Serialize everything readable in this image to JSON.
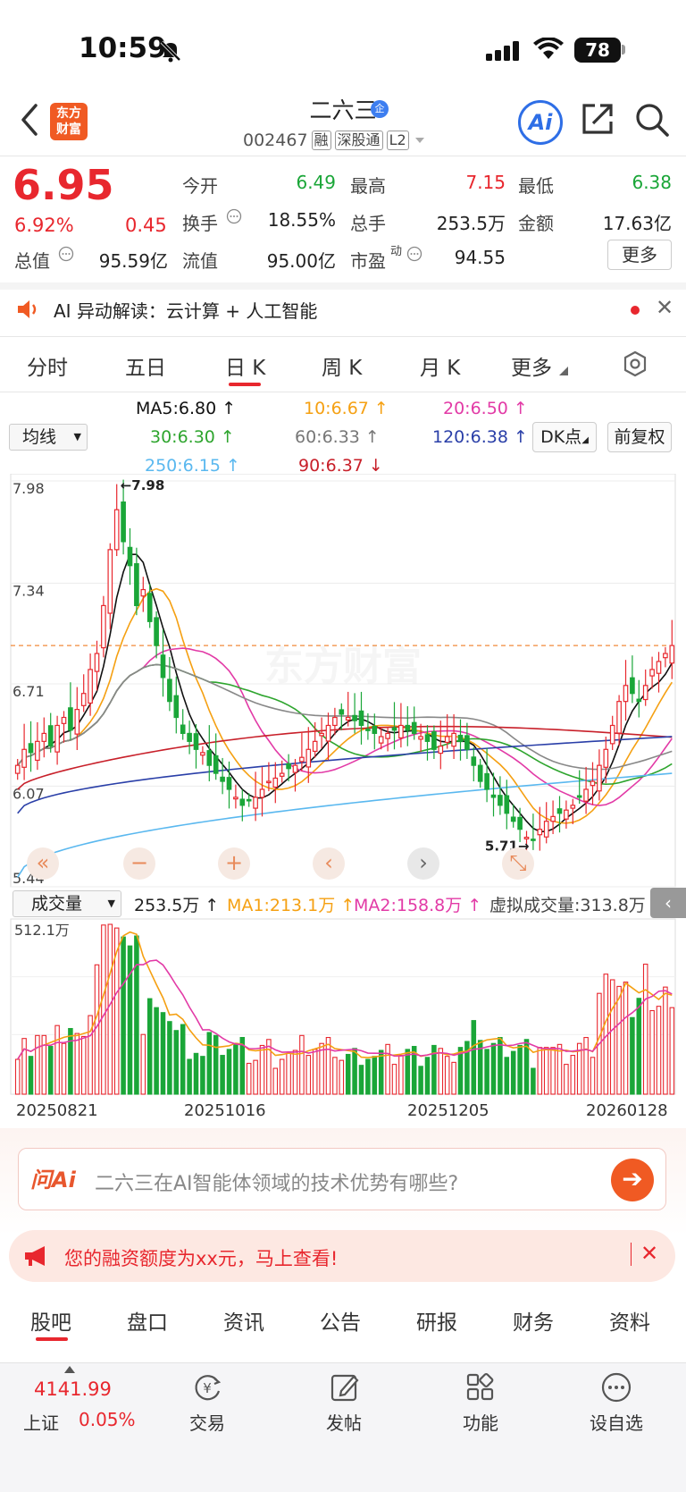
{
  "status_bar": {
    "time": "10:59",
    "battery": "78"
  },
  "header": {
    "stock_name": "二六三",
    "badge": "企",
    "code": "002467",
    "tags": [
      "融",
      "深股通",
      "L2"
    ],
    "logo_line1": "东方",
    "logo_line2": "财富",
    "ai_label": "Ai"
  },
  "quote": {
    "price": "6.95",
    "change_pct": "6.92%",
    "change": "0.45",
    "fields": [
      {
        "label": "今开",
        "value": "6.49",
        "color": "#1aa638"
      },
      {
        "label": "最高",
        "value": "7.15",
        "color": "#e8272e"
      },
      {
        "label": "最低",
        "value": "6.38",
        "color": "#1aa638"
      },
      {
        "label": "换手",
        "value": "18.55%",
        "color": "#222222"
      },
      {
        "label": "总手",
        "value": "253.5万",
        "color": "#222222"
      },
      {
        "label": "金额",
        "value": "17.63亿",
        "color": "#222222"
      },
      {
        "label": "总值",
        "value": "95.59亿",
        "color": "#222222"
      },
      {
        "label": "流值",
        "value": "95.00亿",
        "color": "#222222"
      },
      {
        "label": "市盈",
        "value": "94.55",
        "color": "#222222"
      }
    ],
    "pe_sup": "动",
    "more_label": "更多"
  },
  "ai_bar": {
    "text": "AI 异动解读：云计算 + 人工智能"
  },
  "chart_tabs": [
    "分时",
    "五日",
    "日 K",
    "周 K",
    "月 K",
    "更多"
  ],
  "ma_labels": {
    "select": "均线",
    "ma5": "MA5:6.80 ↑",
    "ma10": "10:6.67 ↑",
    "ma20": "20:6.50 ↑",
    "ma30": "30:6.30 ↑",
    "ma60": "60:6.33 ↑",
    "ma120": "120:6.38 ↑",
    "ma250": "250:6.15 ↑",
    "ma90": "90:6.37 ↓",
    "dk_btn": "DK点",
    "fq_btn": "前复权"
  },
  "colors": {
    "red": "#e8272e",
    "green": "#1aa638",
    "ma5": "#111111",
    "ma10": "#f5a012",
    "ma20": "#e23aa6",
    "ma30": "#2ea52e",
    "ma60": "#888888",
    "ma90": "#c8202a",
    "ma120": "#2a3fa8",
    "ma250": "#5ab8ef"
  },
  "chart_data": {
    "type": "candlestick",
    "y_ticks": [
      "7.98",
      "7.34",
      "6.71",
      "6.07",
      "5.44"
    ],
    "ylim": [
      5.44,
      7.98
    ],
    "high_label": "←7.98",
    "low_label": "5.71→",
    "last_close": 6.95,
    "close": [
      6.2,
      6.3,
      6.28,
      6.35,
      6.4,
      6.32,
      6.45,
      6.5,
      6.42,
      6.55,
      6.65,
      6.8,
      6.9,
      7.2,
      7.55,
      7.8,
      7.6,
      7.45,
      7.2,
      7.3,
      7.1,
      6.95,
      6.75,
      6.6,
      6.5,
      6.4,
      6.35,
      6.3,
      6.28,
      6.2,
      6.15,
      6.1,
      6.05,
      6.0,
      5.95,
      5.98,
      6.0,
      6.05,
      6.1,
      6.12,
      6.15,
      6.18,
      6.2,
      6.25,
      6.3,
      6.35,
      6.4,
      6.45,
      6.5,
      6.52,
      6.5,
      6.48,
      6.45,
      6.42,
      6.4,
      6.38,
      6.4,
      6.42,
      6.45,
      6.42,
      6.4,
      6.38,
      6.35,
      6.3,
      6.32,
      6.38,
      6.4,
      6.35,
      6.3,
      6.2,
      6.1,
      6.05,
      6.0,
      5.95,
      5.9,
      5.85,
      5.8,
      5.75,
      5.73,
      5.8,
      5.85,
      5.88,
      5.9,
      5.92,
      5.95,
      6.0,
      6.05,
      6.1,
      6.2,
      6.3,
      6.45,
      6.6,
      6.7,
      6.65,
      6.6,
      6.7,
      6.8,
      6.85,
      6.9,
      6.95
    ],
    "volume_ylim": [
      0,
      512.1
    ],
    "volume_top_label": "512.1万",
    "x_dates": [
      "20250821",
      "20251016",
      "20251205",
      "20260128"
    ]
  },
  "volume_bar": {
    "select": "成交量",
    "vol": "253.5万 ↑",
    "ma1": "MA1:213.1万 ↑",
    "ma2": "MA2:158.8万 ↑",
    "virtual": "虚拟成交量:313.8万"
  },
  "ask": {
    "logo": "问Ai",
    "placeholder": "二六三在AI智能体领域的技术优势有哪些?"
  },
  "promo": {
    "text": "您的融资额度为xx元，马上查看!"
  },
  "bottom_tabs": [
    "股吧",
    "盘口",
    "资讯",
    "公告",
    "研报",
    "财务",
    "资料"
  ],
  "footer": {
    "index_value": "4141.99",
    "index_name": "上证",
    "index_pct": "0.05%",
    "items": [
      "交易",
      "发帖",
      "功能",
      "设自选"
    ]
  },
  "watermark": "东方财富"
}
